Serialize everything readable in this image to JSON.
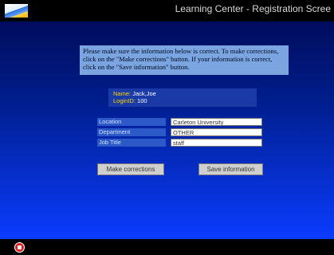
{
  "window": {
    "title": "Learning Center - Registration Scree"
  },
  "notice": {
    "text": "Please make sure the information below is correct. To make corrections, click on the \"Make corrections\" button. If your information is correct, click on the \"Save information\" button."
  },
  "user": {
    "name_label": "Name:",
    "name_value": "Jack,Joe",
    "login_label": "LoginID:",
    "login_value": "100"
  },
  "fields": {
    "location": {
      "label": "Location",
      "value": "Carleton University"
    },
    "department": {
      "label": "Department",
      "value": "OTHER"
    },
    "job_title": {
      "label": "Job Title",
      "value": "staff"
    }
  },
  "buttons": {
    "make_corrections": "Make corrections",
    "save_information": "Save information"
  },
  "colors": {
    "background_top": "#000c5c",
    "background_bottom": "#0b3cff",
    "notice_box": "#7aa5e0",
    "user_box": "#1a3aa8",
    "label_highlight": "#ffd600",
    "stop_button": "#e02020"
  },
  "icons": {
    "logo": "app-logo",
    "stop": "stop-icon"
  }
}
